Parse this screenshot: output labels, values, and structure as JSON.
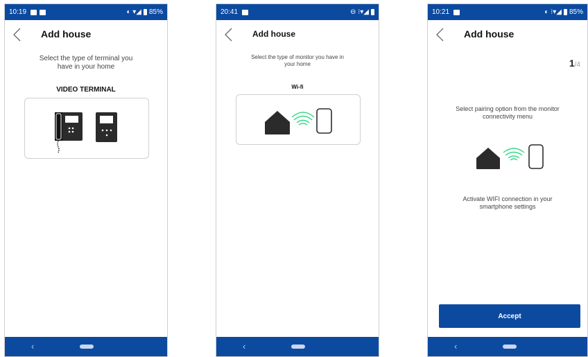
{
  "screens": [
    {
      "status": {
        "time": "10:19",
        "battery": "85%"
      },
      "title": "Add house",
      "description": "Select the type of terminal you have in your home",
      "option_label": "VIDEO TERMINAL",
      "icons": [
        "intercom-handset-icon",
        "video-monitor-icon"
      ]
    },
    {
      "status": {
        "time": "20:41",
        "battery": ""
      },
      "title": "Add house",
      "description": "Select the type of monitor you have in your home",
      "option_label": "Wi-fi",
      "icons": [
        "house-icon",
        "wifi-signal-icon",
        "smartphone-icon"
      ]
    },
    {
      "status": {
        "time": "10:21",
        "battery": "85%"
      },
      "title": "Add house",
      "step": {
        "current": "1",
        "total": "/4"
      },
      "instruction_1": "Select pairing option from the monitor connectivity menu",
      "instruction_2": "Activate WIFI connection in your smartphone settings",
      "accept_label": "Accept",
      "icons": [
        "house-icon",
        "wifi-signal-icon",
        "smartphone-icon"
      ]
    }
  ],
  "colors": {
    "primary": "#0c4aa0",
    "wifi": "#39d98a",
    "icon_dark": "#2b2b2b"
  },
  "system_nav": {
    "back_glyph": "‹"
  }
}
